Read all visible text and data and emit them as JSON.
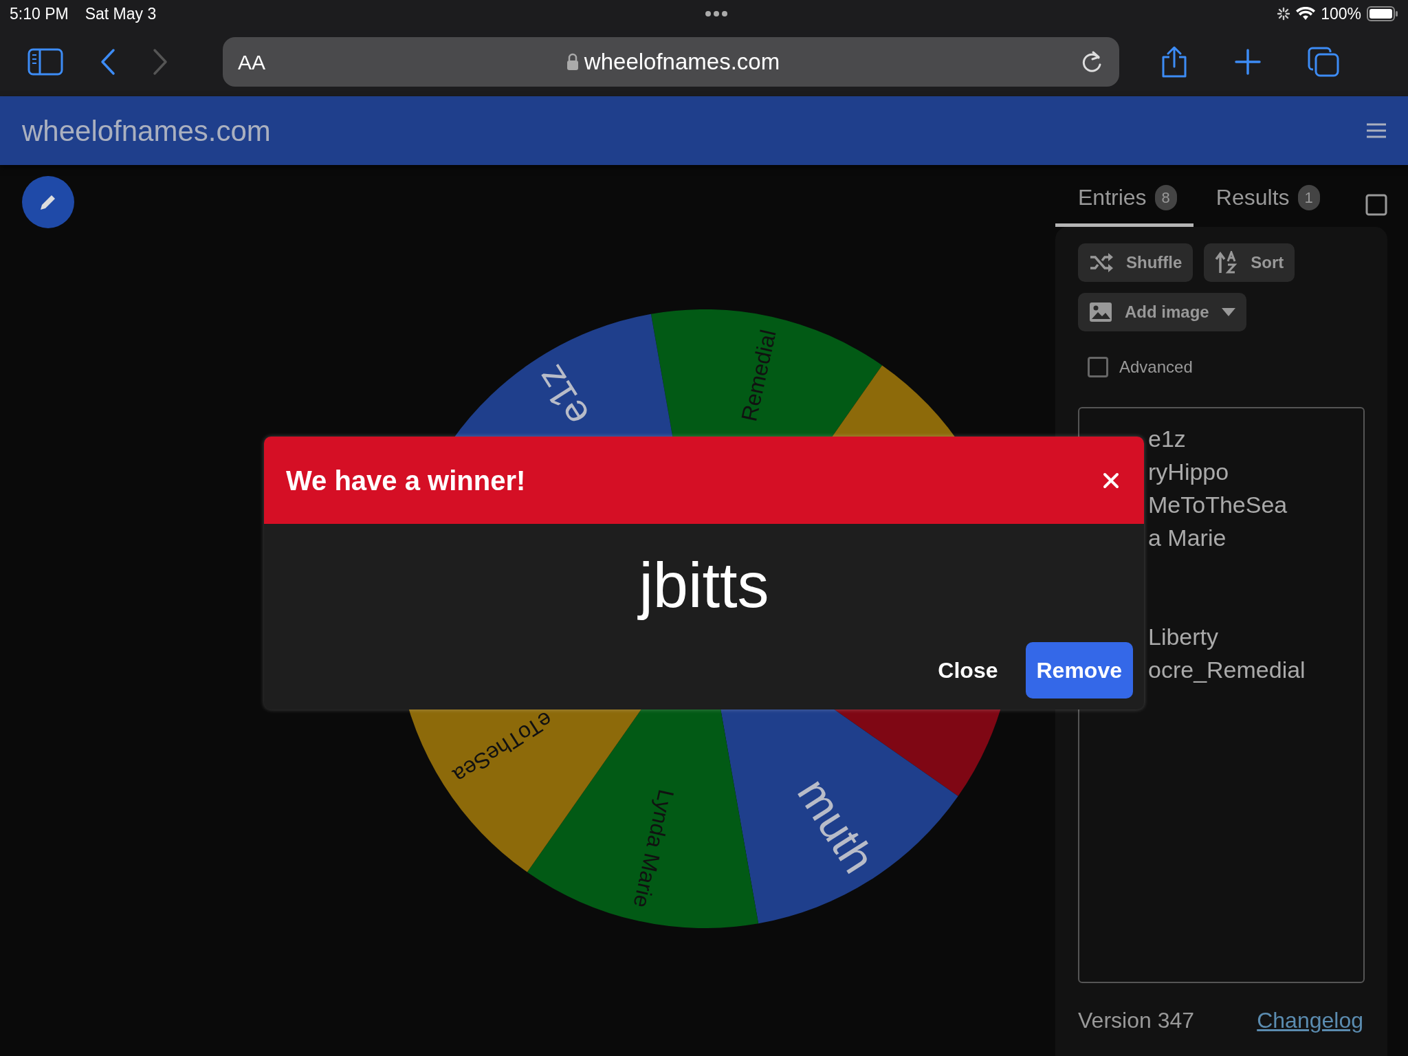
{
  "status_bar": {
    "time": "5:10 PM",
    "date": "Sat May 3",
    "battery": "100%"
  },
  "browser": {
    "text_size_button": "AA",
    "url": "wheelofnames.com",
    "forward_disabled": true
  },
  "navbar": {
    "brand": "wheelofnames.com"
  },
  "wheel": {
    "segments": [
      {
        "color": "#025a15",
        "label": "Remedial"
      },
      {
        "color": "#8d6a0a"
      },
      {
        "color": "#7f0714"
      },
      {
        "color": "#1f3f8c",
        "label": "muth"
      },
      {
        "color": "#025a15",
        "label": "Lynda Marie"
      },
      {
        "color": "#8d6a0a",
        "label": "eToTheSea"
      }
    ],
    "top_left_segment": {
      "color": "#1f3f8c",
      "label": "e1z"
    }
  },
  "modal": {
    "title": "We have a winner!",
    "winner": "jbitts",
    "buttons": [
      {
        "label": "Close",
        "kind": "text"
      },
      {
        "label": "Remove",
        "kind": "primary"
      }
    ]
  },
  "panel": {
    "tabs": [
      {
        "label": "Entries",
        "count": "8",
        "selected": true
      },
      {
        "label": "Results",
        "count": "1",
        "selected": false
      }
    ],
    "tools": [
      {
        "label": "Shuffle",
        "kind": "shuffle",
        "dropdown": false
      },
      {
        "label": "Sort",
        "kind": "sort",
        "dropdown": false
      },
      {
        "label": "Add image",
        "kind": "image",
        "dropdown": true
      }
    ],
    "advanced": {
      "label": "Advanced",
      "checked": false
    },
    "entries_top": [
      "e1z",
      "ryHippo",
      "MeToTheSea",
      "a Marie"
    ],
    "entries_bottom": [
      "Liberty",
      "ocre_Remedial"
    ],
    "version": "Version 347",
    "changelog": "Changelog"
  }
}
